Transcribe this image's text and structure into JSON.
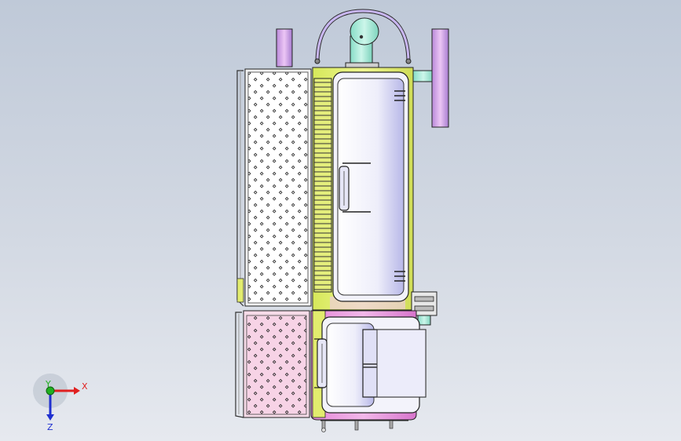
{
  "viewport": {
    "background_top": "#bfc9d8",
    "background_bottom": "#e6e9ef"
  },
  "model": {
    "parts": [
      "top-pipe-elbow",
      "lifting-handle",
      "left-vertical-bar",
      "right-flywheel",
      "upper-perforated-panel",
      "cooling-fins",
      "main-tank-body",
      "upper-door",
      "door-handle",
      "side-clamp-bracket",
      "lower-perforated-panel",
      "lower-tank-body",
      "lower-door",
      "bottom-feet"
    ],
    "colors": {
      "outline": "#1c1c1c",
      "tank_yellow": "#e2ec6e",
      "tank_pink": "#e48bd8",
      "pipe_cyan": "#a6ead6",
      "bar_purple": "#d49ee8",
      "panel_white": "#ffffff",
      "lower_panel_pink": "#f7d3e6",
      "door_lavender": "#dcdcf5"
    }
  },
  "triad": {
    "x_label": "X",
    "y_label": "Y",
    "z_label": "Z",
    "x_color": "#e02020",
    "y_color": "#20b020",
    "z_color": "#2030d0"
  }
}
